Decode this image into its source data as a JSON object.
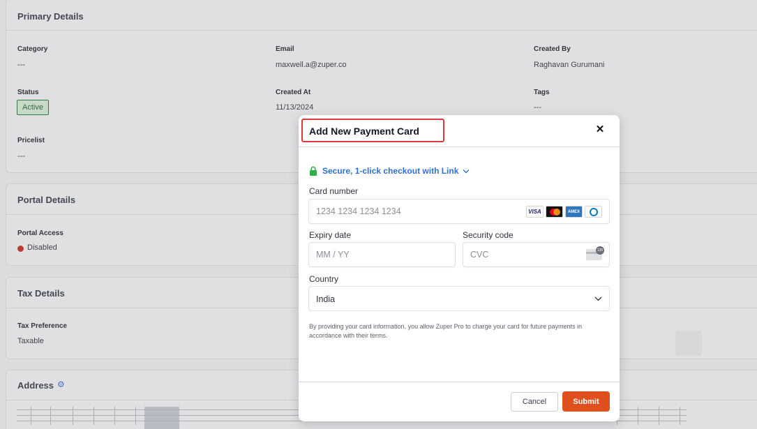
{
  "background": {
    "primary_details": {
      "title": "Primary Details",
      "category_label": "Category",
      "category_value": "---",
      "email_label": "Email",
      "email_value": "maxwell.a@zuper.co",
      "created_by_label": "Created By",
      "created_by_value": "Raghavan Gurumani",
      "status_label": "Status",
      "status_value": "Active",
      "created_at_label": "Created At",
      "created_at_value": "11/13/2024",
      "tags_label": "Tags",
      "tags_value": "---",
      "pricelist_label": "Pricelist",
      "pricelist_value": "---"
    },
    "portal_details": {
      "title": "Portal Details",
      "portal_access_label": "Portal Access",
      "portal_access_value": "Disabled"
    },
    "tax_details": {
      "title": "Tax Details",
      "tax_preference_label": "Tax Preference",
      "tax_preference_value": "Taxable"
    },
    "address": {
      "title": "Address",
      "icon": "gear-icon"
    }
  },
  "modal": {
    "title": "Add New Payment Card",
    "close_icon": "close-icon",
    "link_text": "Secure, 1-click checkout with Link",
    "card_number_label": "Card number",
    "card_number_placeholder": "1234 1234 1234 1234",
    "card_brands": [
      "VISA",
      "mastercard",
      "AMEX",
      "diners"
    ],
    "expiry_label": "Expiry date",
    "expiry_placeholder": "MM / YY",
    "security_label": "Security code",
    "security_placeholder": "CVC",
    "cvc_badge": "135",
    "country_label": "Country",
    "country_value": "India",
    "legal_text": "By providing your card information, you allow Zuper Pro to charge your card for future payments in accordance with their terms.",
    "cancel_label": "Cancel",
    "submit_label": "Submit"
  },
  "colors": {
    "accent_submit": "#e0501f",
    "link_blue": "#2f6fd1",
    "highlight_red": "#d9393d",
    "lock_green": "#2bb34a",
    "status_active": "#2d7d3a",
    "status_disabled": "#c0392b"
  }
}
